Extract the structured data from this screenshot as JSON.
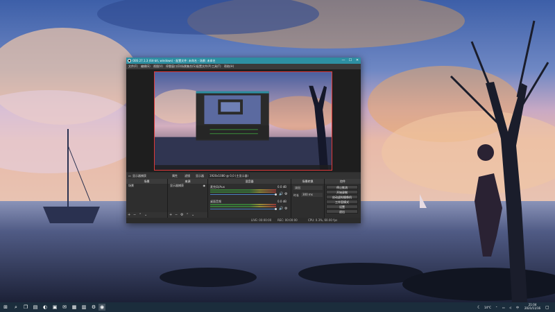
{
  "window": {
    "title": "OBS 27.1.3 (64-bit, windows) - 配置文件: 未命名 - 场景: 未命名",
    "min_label": "—",
    "max_label": "☐",
    "close_label": "✕"
  },
  "menubar": [
    "文件(F)",
    "编辑(E)",
    "视图(V)",
    "停靠窗口(D)",
    "场景集合(S)",
    "配置文件(P)",
    "工具(T)",
    "帮助(H)"
  ],
  "source_toolbar": {
    "no_source": "显示器捕获",
    "properties": "属性",
    "filters": "滤镜",
    "display_label": "显示器",
    "display_value": "1920x1080 @ 0,0 (主显示器)"
  },
  "docks": {
    "scenes": {
      "header": "场景",
      "items": [
        "场景"
      ]
    },
    "sources": {
      "header": "来源",
      "items": [
        "显示器捕获"
      ]
    },
    "mixer": {
      "header": "混音器",
      "channels": [
        {
          "name": "麦克风/Aux",
          "db": "0.0 dB"
        },
        {
          "name": "桌面音频",
          "db": "0.0 dB"
        }
      ]
    },
    "transitions": {
      "header": "场景转换",
      "transition_value": "淡出",
      "duration_label": "时长",
      "duration_value": "300 ms"
    },
    "controls": {
      "header": "控件",
      "buttons": [
        "停止推流",
        "开始录制",
        "启动虚拟摄像机",
        "工作室模式",
        "设置",
        "退出"
      ]
    }
  },
  "statusbar": {
    "live": "LIVE: 00:00:00",
    "rec": "REC: 00:00:00",
    "cpu": "CPU: 0.3%, 60.00 fps"
  },
  "taskbar": {
    "weather": "14°C",
    "time": "21:04",
    "date": "2021/11/16"
  }
}
